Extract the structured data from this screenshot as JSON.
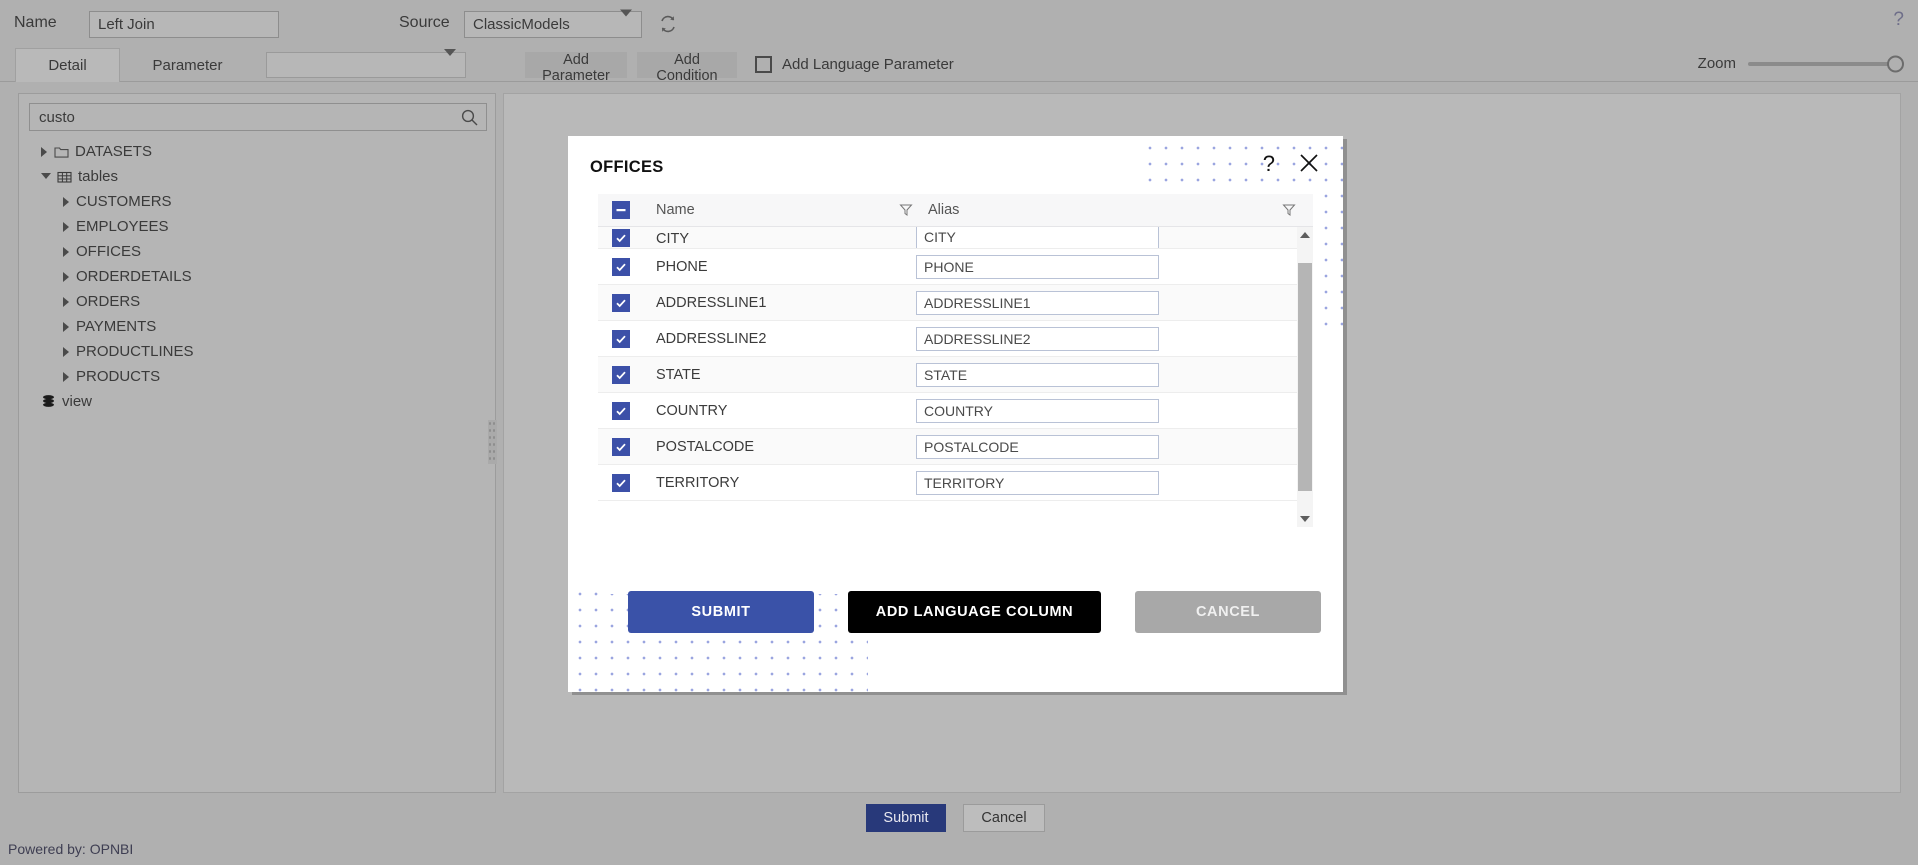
{
  "topbar": {
    "name_label": "Name",
    "name_value": "Left Join",
    "source_label": "Source",
    "source_value": "ClassicModels",
    "refresh_icon": "refresh-icon",
    "help_icon": "?"
  },
  "tabs": {
    "detail": "Detail",
    "parameter": "Parameter",
    "param_select_value": "",
    "add_parameter": "Add Parameter",
    "add_condition": "Add Condition",
    "add_language_parameter": "Add Language Parameter",
    "zoom_label": "Zoom"
  },
  "sidebar": {
    "search_value": "custo",
    "search_placeholder": "",
    "tree": [
      {
        "label": "DATASETS",
        "level": 0,
        "expanded": false,
        "icon": "folder-icon"
      },
      {
        "label": "tables",
        "level": 0,
        "expanded": true,
        "icon": "table-icon"
      },
      {
        "label": "CUSTOMERS",
        "level": 1,
        "expanded": false,
        "icon": ""
      },
      {
        "label": "EMPLOYEES",
        "level": 1,
        "expanded": false,
        "icon": ""
      },
      {
        "label": "OFFICES",
        "level": 1,
        "expanded": false,
        "icon": ""
      },
      {
        "label": "ORDERDETAILS",
        "level": 1,
        "expanded": false,
        "icon": ""
      },
      {
        "label": "ORDERS",
        "level": 1,
        "expanded": false,
        "icon": ""
      },
      {
        "label": "PAYMENTS",
        "level": 1,
        "expanded": false,
        "icon": ""
      },
      {
        "label": "PRODUCTLINES",
        "level": 1,
        "expanded": false,
        "icon": ""
      },
      {
        "label": "PRODUCTS",
        "level": 1,
        "expanded": false,
        "icon": ""
      },
      {
        "label": "view",
        "level": 0,
        "expanded": null,
        "icon": "database-icon"
      }
    ]
  },
  "modal": {
    "title": "OFFICES",
    "help_icon": "?",
    "close_icon": "close-icon",
    "columns": {
      "name": "Name",
      "alias": "Alias"
    },
    "header_checkbox_state": "indeterminate",
    "rows": [
      {
        "checked": true,
        "name": "CITY",
        "alias": "CITY"
      },
      {
        "checked": true,
        "name": "PHONE",
        "alias": "PHONE"
      },
      {
        "checked": true,
        "name": "ADDRESSLINE1",
        "alias": "ADDRESSLINE1"
      },
      {
        "checked": true,
        "name": "ADDRESSLINE2",
        "alias": "ADDRESSLINE2"
      },
      {
        "checked": true,
        "name": "STATE",
        "alias": "STATE"
      },
      {
        "checked": true,
        "name": "COUNTRY",
        "alias": "COUNTRY"
      },
      {
        "checked": true,
        "name": "POSTALCODE",
        "alias": "POSTALCODE"
      },
      {
        "checked": true,
        "name": "TERRITORY",
        "alias": "TERRITORY"
      }
    ],
    "buttons": {
      "submit": "SUBMIT",
      "add_language_column": "ADD LANGUAGE COLUMN",
      "cancel": "CANCEL"
    }
  },
  "footer": {
    "submit": "Submit",
    "cancel": "Cancel",
    "powered_by": "Powered by: OPNBI"
  },
  "colors": {
    "accent_blue": "#3a52a8",
    "checkbox_blue": "#3c50a8",
    "app_gray": "#b0b0b0",
    "black_button": "#000000",
    "cancel_gray": "#a8a8a8",
    "dot_pattern": "#9aa5e0"
  }
}
